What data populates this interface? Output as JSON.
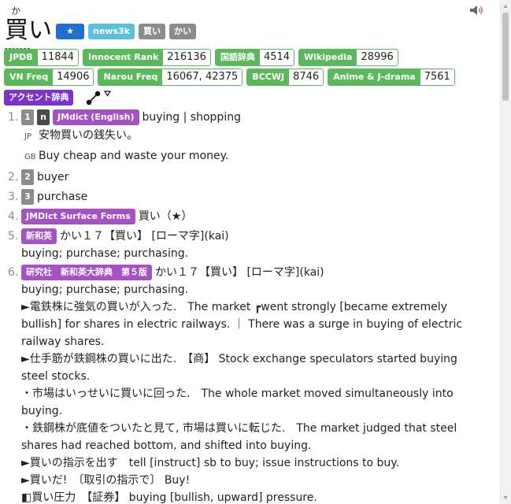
{
  "entry": {
    "word": "買い",
    "reading": "か"
  },
  "header_tags": {
    "star": "★",
    "news": "news3k",
    "tag1": "買い",
    "tag2": "かい"
  },
  "freq": [
    {
      "label": "JPDB",
      "value": "11844"
    },
    {
      "label": "Innocent Rank",
      "value": "216136"
    },
    {
      "label": "国語辞典",
      "value": "4514"
    },
    {
      "label": "Wikipedia",
      "value": "28996"
    },
    {
      "label": "VN Freq",
      "value": "14906"
    },
    {
      "label": "Narou Freq",
      "value": "16067, 42375"
    },
    {
      "label": "BCCWJ",
      "value": "8746"
    },
    {
      "label": "Anime & J-drama",
      "value": "7561"
    }
  ],
  "accent": {
    "label": "アクセント辞典"
  },
  "icons": {
    "speaker": "speaker-icon",
    "pitch": "pitch-accent-icon",
    "star": "star-icon"
  },
  "colors": {
    "green": "#5cb85c",
    "purple": "#7a35c8",
    "violet": "#a552c4",
    "news": "#5bc0de",
    "blue": "#1f6fd1"
  },
  "definitions": [
    {
      "num": "1.",
      "box1": "1",
      "box2": "n",
      "dict": "JMdict (English)",
      "gloss": "buying | shopping",
      "ex_jp_lang": "JP",
      "ex_jp": "安物買いの銭失い。",
      "ex_en_lang": "GB",
      "ex_en": "Buy cheap and waste your money."
    },
    {
      "num": "2.",
      "box": "2",
      "gloss": "buyer"
    },
    {
      "num": "3.",
      "box": "3",
      "gloss": "purchase"
    },
    {
      "num": "4.",
      "dict": "JMDict Surface Forms",
      "gloss": "買い（★）"
    },
    {
      "num": "5.",
      "dict": "新和英",
      "gloss": "かい１７【買い】 [ローマ字](kai)",
      "sub": "buying; purchase; purchasing."
    },
    {
      "num": "6.",
      "dict": "研究社　新和英大辞典　第５版",
      "gloss": "かい１７【買い】 [ローマ字](kai)",
      "sub": "buying; purchase; purchasing.",
      "lines": [
        "►電鉄株に強気の買いが入った.　The market ┏went strongly [became extremely bullish] for shares in electric railways. ｜ There was a surge in buying of electric railway shares.",
        "►仕手筋が鉄鋼株の買いに出た.　【商】 Stock exchange speculators started buying steel stocks.",
        "・市場はいっせいに買いに回った.　The whole market moved simultaneously into buying.",
        "・鉄鋼株が底値をついたと見て, 市場は買いに転じた.　The market judged that steel shares had reached bottom, and shifted into buying.",
        "►買いの指示を出す　tell [instruct] sb to buy; issue instructions to buy.",
        "►買いだ!　〔取引の指示で〕 Buy!",
        "◧買い圧力　【証券】 buying [bullish, upward] pressure."
      ]
    }
  ]
}
